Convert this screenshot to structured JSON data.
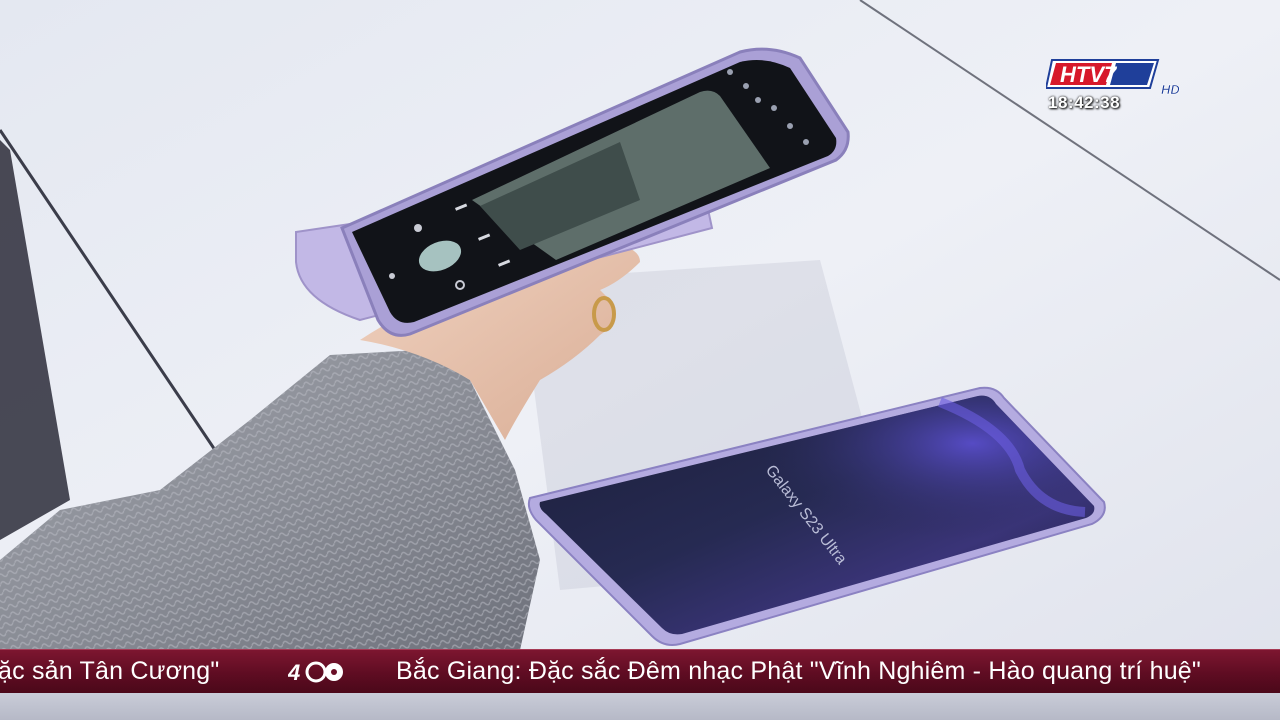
{
  "channel": {
    "logo_text": "HTV7",
    "logo_suffix": "HD",
    "clock": "18:42:38"
  },
  "scene": {
    "phone_screen_text": "Galaxy S23 Ultra"
  },
  "ticker": {
    "left_text": "ặc sản Tân Cương\"",
    "right_text": "Bắc Giang: Đặc sắc Đêm nhạc Phật \"Vĩnh Nghiêm - Hào quang trí huệ\""
  },
  "colors": {
    "ticker_bg": "#6a0f27",
    "logo_red": "#d7182a",
    "logo_blue": "#1f3f9a"
  }
}
